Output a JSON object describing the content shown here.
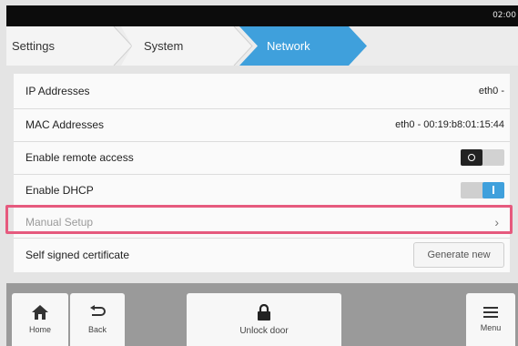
{
  "status": {
    "time": "02:00"
  },
  "breadcrumb": [
    {
      "label": "Settings"
    },
    {
      "label": "System"
    },
    {
      "label": "Network"
    }
  ],
  "rows": {
    "ip": {
      "label": "IP Addresses",
      "value": "eth0 -"
    },
    "mac": {
      "label": "MAC Addresses",
      "value": "eth0 - 00:19:b8:01:15:44"
    },
    "remote": {
      "label": "Enable remote access",
      "state": "off"
    },
    "dhcp": {
      "label": "Enable DHCP",
      "state": "on"
    },
    "manual": {
      "label": "Manual Setup",
      "chevron": "›"
    },
    "cert": {
      "label": "Self signed certificate",
      "button": "Generate new"
    }
  },
  "toolbar": {
    "home": "Home",
    "back": "Back",
    "unlock": "Unlock door",
    "menu": "Menu"
  },
  "colors": {
    "accent": "#3fa0dc",
    "highlight": "#e65a7e"
  }
}
